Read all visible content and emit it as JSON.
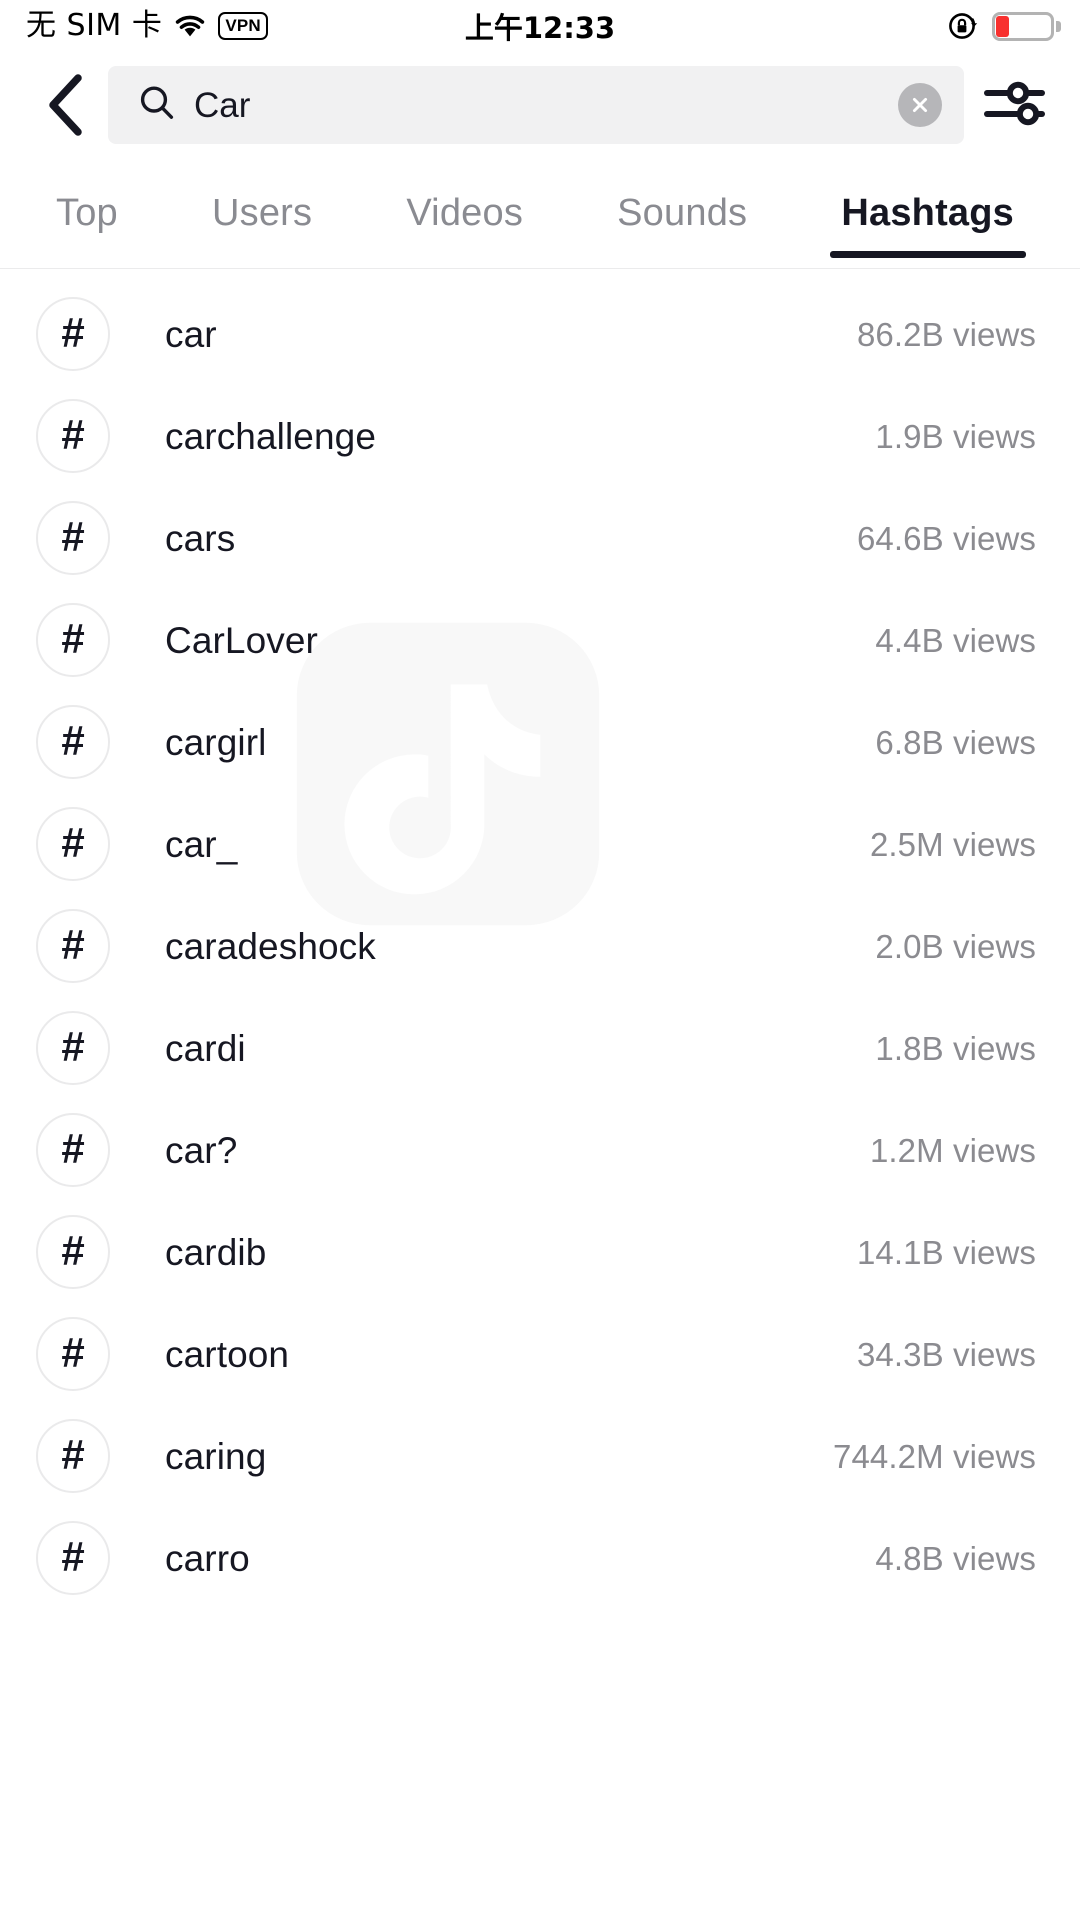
{
  "status_bar": {
    "carrier": "无 SIM 卡",
    "wifi_icon": "wifi-icon",
    "vpn_label": "VPN",
    "time": "上午12:33",
    "rotation_lock_icon": "rotation-lock-icon",
    "battery_icon": "battery-low-icon",
    "battery_color": "#f8312f"
  },
  "header": {
    "back_icon": "chevron-left-icon",
    "search_icon": "search-icon",
    "search_value": "Car",
    "search_placeholder": "Search",
    "clear_icon": "close-circle-icon",
    "filter_icon": "filter-sliders-icon"
  },
  "tabs": {
    "items": [
      {
        "label": "Top",
        "active": false
      },
      {
        "label": "Users",
        "active": false
      },
      {
        "label": "Videos",
        "active": false
      },
      {
        "label": "Sounds",
        "active": false
      },
      {
        "label": "Hashtags",
        "active": true
      }
    ],
    "active_index": 4,
    "active_color": "#161722",
    "inactive_color": "#8a8b91"
  },
  "results": {
    "hash_icon": "hashtag-icon",
    "items": [
      {
        "name": "car",
        "views": "86.2B views"
      },
      {
        "name": "carchallenge",
        "views": "1.9B views"
      },
      {
        "name": "cars",
        "views": "64.6B views"
      },
      {
        "name": "CarLover",
        "views": "4.4B views"
      },
      {
        "name": "cargirl",
        "views": "6.8B views"
      },
      {
        "name": "car_",
        "views": "2.5M views"
      },
      {
        "name": "caradeshock",
        "views": "2.0B views"
      },
      {
        "name": "cardi",
        "views": "1.8B views"
      },
      {
        "name": "car?",
        "views": "1.2M views"
      },
      {
        "name": "cardib",
        "views": "14.1B views"
      },
      {
        "name": "cartoon",
        "views": "34.3B views"
      },
      {
        "name": "caring",
        "views": "744.2M views"
      },
      {
        "name": "carro",
        "views": "4.8B views"
      }
    ]
  },
  "watermark": {
    "icon": "app-logo-watermark-icon"
  }
}
